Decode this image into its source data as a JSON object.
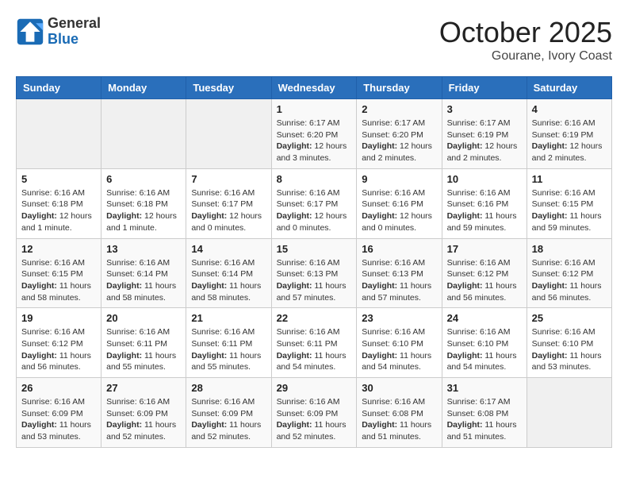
{
  "header": {
    "logo_general": "General",
    "logo_blue": "Blue",
    "month_title": "October 2025",
    "location": "Gourane, Ivory Coast"
  },
  "days_of_week": [
    "Sunday",
    "Monday",
    "Tuesday",
    "Wednesday",
    "Thursday",
    "Friday",
    "Saturday"
  ],
  "weeks": [
    [
      {
        "day": "",
        "info": ""
      },
      {
        "day": "",
        "info": ""
      },
      {
        "day": "",
        "info": ""
      },
      {
        "day": "1",
        "sunrise": "6:17 AM",
        "sunset": "6:20 PM",
        "daylight": "12 hours and 3 minutes."
      },
      {
        "day": "2",
        "sunrise": "6:17 AM",
        "sunset": "6:20 PM",
        "daylight": "12 hours and 2 minutes."
      },
      {
        "day": "3",
        "sunrise": "6:17 AM",
        "sunset": "6:19 PM",
        "daylight": "12 hours and 2 minutes."
      },
      {
        "day": "4",
        "sunrise": "6:16 AM",
        "sunset": "6:19 PM",
        "daylight": "12 hours and 2 minutes."
      }
    ],
    [
      {
        "day": "5",
        "sunrise": "6:16 AM",
        "sunset": "6:18 PM",
        "daylight": "12 hours and 1 minute."
      },
      {
        "day": "6",
        "sunrise": "6:16 AM",
        "sunset": "6:18 PM",
        "daylight": "12 hours and 1 minute."
      },
      {
        "day": "7",
        "sunrise": "6:16 AM",
        "sunset": "6:17 PM",
        "daylight": "12 hours and 0 minutes."
      },
      {
        "day": "8",
        "sunrise": "6:16 AM",
        "sunset": "6:17 PM",
        "daylight": "12 hours and 0 minutes."
      },
      {
        "day": "9",
        "sunrise": "6:16 AM",
        "sunset": "6:16 PM",
        "daylight": "12 hours and 0 minutes."
      },
      {
        "day": "10",
        "sunrise": "6:16 AM",
        "sunset": "6:16 PM",
        "daylight": "11 hours and 59 minutes."
      },
      {
        "day": "11",
        "sunrise": "6:16 AM",
        "sunset": "6:15 PM",
        "daylight": "11 hours and 59 minutes."
      }
    ],
    [
      {
        "day": "12",
        "sunrise": "6:16 AM",
        "sunset": "6:15 PM",
        "daylight": "11 hours and 58 minutes."
      },
      {
        "day": "13",
        "sunrise": "6:16 AM",
        "sunset": "6:14 PM",
        "daylight": "11 hours and 58 minutes."
      },
      {
        "day": "14",
        "sunrise": "6:16 AM",
        "sunset": "6:14 PM",
        "daylight": "11 hours and 58 minutes."
      },
      {
        "day": "15",
        "sunrise": "6:16 AM",
        "sunset": "6:13 PM",
        "daylight": "11 hours and 57 minutes."
      },
      {
        "day": "16",
        "sunrise": "6:16 AM",
        "sunset": "6:13 PM",
        "daylight": "11 hours and 57 minutes."
      },
      {
        "day": "17",
        "sunrise": "6:16 AM",
        "sunset": "6:12 PM",
        "daylight": "11 hours and 56 minutes."
      },
      {
        "day": "18",
        "sunrise": "6:16 AM",
        "sunset": "6:12 PM",
        "daylight": "11 hours and 56 minutes."
      }
    ],
    [
      {
        "day": "19",
        "sunrise": "6:16 AM",
        "sunset": "6:12 PM",
        "daylight": "11 hours and 56 minutes."
      },
      {
        "day": "20",
        "sunrise": "6:16 AM",
        "sunset": "6:11 PM",
        "daylight": "11 hours and 55 minutes."
      },
      {
        "day": "21",
        "sunrise": "6:16 AM",
        "sunset": "6:11 PM",
        "daylight": "11 hours and 55 minutes."
      },
      {
        "day": "22",
        "sunrise": "6:16 AM",
        "sunset": "6:11 PM",
        "daylight": "11 hours and 54 minutes."
      },
      {
        "day": "23",
        "sunrise": "6:16 AM",
        "sunset": "6:10 PM",
        "daylight": "11 hours and 54 minutes."
      },
      {
        "day": "24",
        "sunrise": "6:16 AM",
        "sunset": "6:10 PM",
        "daylight": "11 hours and 54 minutes."
      },
      {
        "day": "25",
        "sunrise": "6:16 AM",
        "sunset": "6:10 PM",
        "daylight": "11 hours and 53 minutes."
      }
    ],
    [
      {
        "day": "26",
        "sunrise": "6:16 AM",
        "sunset": "6:09 PM",
        "daylight": "11 hours and 53 minutes."
      },
      {
        "day": "27",
        "sunrise": "6:16 AM",
        "sunset": "6:09 PM",
        "daylight": "11 hours and 52 minutes."
      },
      {
        "day": "28",
        "sunrise": "6:16 AM",
        "sunset": "6:09 PM",
        "daylight": "11 hours and 52 minutes."
      },
      {
        "day": "29",
        "sunrise": "6:16 AM",
        "sunset": "6:09 PM",
        "daylight": "11 hours and 52 minutes."
      },
      {
        "day": "30",
        "sunrise": "6:16 AM",
        "sunset": "6:08 PM",
        "daylight": "11 hours and 51 minutes."
      },
      {
        "day": "31",
        "sunrise": "6:17 AM",
        "sunset": "6:08 PM",
        "daylight": "11 hours and 51 minutes."
      },
      {
        "day": "",
        "info": ""
      }
    ]
  ],
  "labels": {
    "sunrise": "Sunrise:",
    "sunset": "Sunset:",
    "daylight": "Daylight:"
  }
}
